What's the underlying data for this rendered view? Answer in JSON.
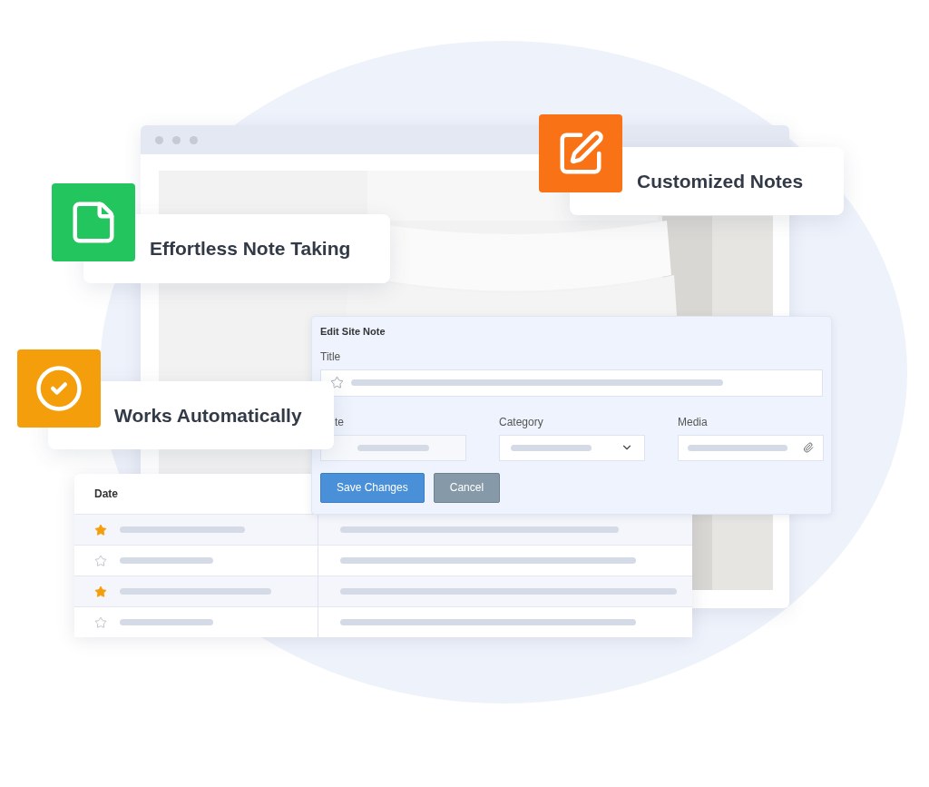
{
  "features": [
    {
      "label": "Customized Notes",
      "color": "#f97316",
      "kind": "edit"
    },
    {
      "label": "Effortless Note Taking",
      "color": "#22c55e",
      "kind": "note"
    },
    {
      "label": "Works Automatically",
      "color": "#f59e0b",
      "kind": "check"
    }
  ],
  "form": {
    "title": "Edit Site Note",
    "fields": [
      {
        "label": "Title",
        "kind": "textarea"
      },
      {
        "label": "te",
        "kind": "text"
      },
      {
        "label": "Category",
        "kind": "select"
      },
      {
        "label": "Media",
        "kind": "file"
      }
    ],
    "buttons": [
      {
        "label": "Save Changes",
        "kind": "primary"
      },
      {
        "label": "Cancel",
        "kind": "secondary"
      }
    ]
  },
  "table": {
    "columns": [
      "Date"
    ],
    "rows": [
      {
        "starred": true
      },
      {
        "starred": false
      },
      {
        "starred": true
      },
      {
        "starred": false
      }
    ]
  }
}
